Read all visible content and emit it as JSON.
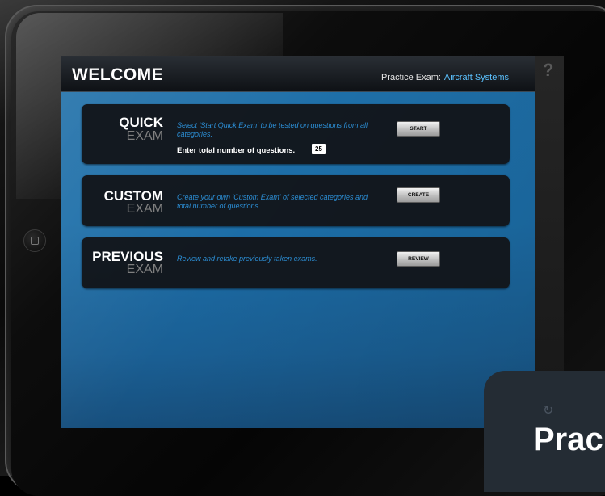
{
  "header": {
    "title": "WELCOME",
    "practice_label": "Practice Exam:",
    "practice_subject": "Aircraft Systems"
  },
  "help_icon_glyph": "?",
  "cards": [
    {
      "title": "QUICK",
      "subtitle": "EXAM",
      "description": "Select 'Start Quick Exam' to be tested on questions from all categories.",
      "button_label": "START",
      "question_prompt": "Enter total number of questions.",
      "question_count": "25"
    },
    {
      "title": "CUSTOM",
      "subtitle": "EXAM",
      "description": "Create your own 'Custom Exam' of selected categories and total number of questions.",
      "button_label": "CREATE"
    },
    {
      "title": "PREVIOUS",
      "subtitle": "EXAM",
      "description": "Review and retake previously taken exams.",
      "button_label": "REVIEW"
    }
  ],
  "overlay": {
    "text": "Prac",
    "icon": "rotate-icon"
  },
  "colors": {
    "accent": "#5cc2ff",
    "screen_bg": "#1f6fa8",
    "card_bg": "#121418"
  }
}
